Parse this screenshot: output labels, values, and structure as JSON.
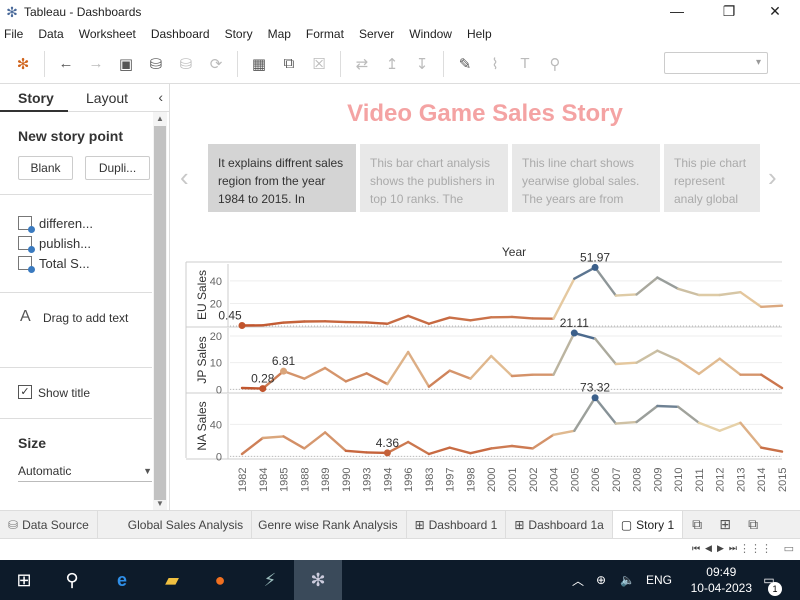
{
  "window": {
    "title": "Tableau - Dashboards",
    "icon": "tableau-logo-icon"
  },
  "menu": [
    "File",
    "Data",
    "Worksheet",
    "Dashboard",
    "Story",
    "Map",
    "Format",
    "Server",
    "Window",
    "Help"
  ],
  "left_panel": {
    "tabs": [
      "Story",
      "Layout"
    ],
    "new_story_point": "New story point",
    "blank_button": "Blank",
    "duplicate_button": "Dupli...",
    "sheets": [
      "differen...",
      "publish...",
      "Total S..."
    ],
    "drag_text": "Drag to add text",
    "show_title": "Show title",
    "size_label": "Size",
    "size_value": "Automatic"
  },
  "story": {
    "title": "Video Game Sales Story",
    "points": [
      "It explains diffrent sales region from the year 1984 to 2015. In",
      "This bar chart analysis shows the publishers in top 10 ranks. The",
      "This line chart shows yearwise  global sales. The years are from",
      "This pie chart represent analy global sales of t"
    ]
  },
  "chart_data": {
    "type": "line",
    "title": "Year",
    "x": [
      "1982",
      "1984",
      "1985",
      "1988",
      "1989",
      "1990",
      "1993",
      "1994",
      "1996",
      "1983",
      "1997",
      "1998",
      "2000",
      "2001",
      "2002",
      "2004",
      "2005",
      "2006",
      "2007",
      "2008",
      "2009",
      "2010",
      "2011",
      "2012",
      "2013",
      "2014",
      "2015"
    ],
    "series": [
      {
        "name": "EU Sales",
        "values": [
          0.45,
          0.6,
          3,
          4,
          4.2,
          3.5,
          3.2,
          2,
          9,
          2,
          7.5,
          5,
          7.7,
          8,
          6.7,
          6.5,
          42,
          51.97,
          27,
          28,
          43,
          33,
          27.5,
          27.5,
          30,
          17,
          18
        ],
        "labels": [
          {
            "x": "1982",
            "text": "0.45"
          },
          {
            "x": "2006",
            "text": "51.97"
          }
        ]
      },
      {
        "name": "JP Sales",
        "values": [
          0.5,
          0.28,
          6.81,
          4,
          8,
          3,
          6,
          2,
          14,
          1,
          7,
          4,
          12.5,
          5,
          5.5,
          5.5,
          21.11,
          19,
          9.5,
          10,
          14.5,
          11,
          5.8,
          11.5,
          5.5,
          5.5,
          0.5
        ],
        "labels": [
          {
            "x": "1984",
            "text": "0.28"
          },
          {
            "x": "1985",
            "text": "6.81"
          },
          {
            "x": "2005",
            "text": "21.11"
          }
        ]
      },
      {
        "name": "NA Sales",
        "values": [
          3,
          23,
          25,
          10,
          30,
          7,
          5,
          4.36,
          18,
          3,
          11,
          4,
          10,
          13,
          10,
          27,
          32,
          73.32,
          41,
          43,
          63,
          62,
          42,
          32,
          42,
          11,
          6
        ],
        "labels": [
          {
            "x": "1994",
            "text": "4.36"
          },
          {
            "x": "2006",
            "text": "73.32"
          }
        ]
      }
    ],
    "yticks": {
      "EU Sales": [
        20,
        40
      ],
      "JP Sales": [
        0,
        10,
        20
      ],
      "NA Sales": [
        0,
        40
      ]
    },
    "highlight_color": "#3b5f8a",
    "low_color": "#c0522a",
    "mid_color": "#e8d2a8"
  },
  "sheet_tabs": [
    "Data Source",
    "Global Sales Analysis",
    "Genre wise Rank Analysis",
    "Dashboard 1",
    "Dashboard 1a",
    "Story 1"
  ],
  "taskbar": {
    "language": "ENG",
    "time": "09:49",
    "date": "10-04-2023",
    "notifications": "1"
  }
}
